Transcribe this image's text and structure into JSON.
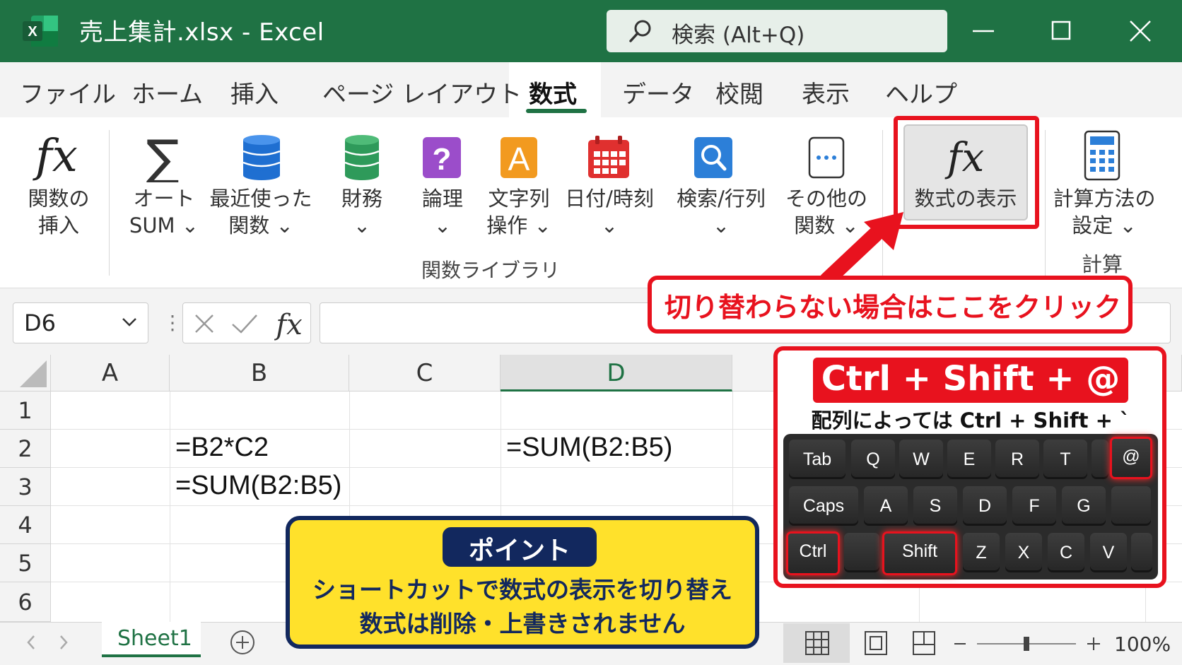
{
  "window": {
    "title": "売上集計.xlsx  -  Excel",
    "search_placeholder": "検索 (Alt+Q)",
    "brand_color": "#1f7244"
  },
  "menu": {
    "tabs": [
      "ファイル",
      "ホーム",
      "挿入",
      "ページ レイアウト",
      "数式",
      "データ",
      "校閲",
      "表示",
      "ヘルプ"
    ],
    "active_tab": "数式"
  },
  "ribbon": {
    "insert_function": {
      "line1": "関数の",
      "line2": "挿入"
    },
    "autosum": {
      "line1": "オート",
      "line2": "SUM ⌄"
    },
    "recent": {
      "line1": "最近使った",
      "line2": "関数 ⌄"
    },
    "financial": {
      "line1": "財務",
      "line2": "⌄"
    },
    "logical": {
      "line1": "論理",
      "line2": "⌄"
    },
    "text": {
      "line1": "文字列",
      "line2": "操作 ⌄"
    },
    "datetime": {
      "line1": "日付/時刻",
      "line2": "⌄"
    },
    "lookup": {
      "line1": "検索/行列",
      "line2": "⌄"
    },
    "more": {
      "line1": "その他の",
      "line2": "関数 ⌄"
    },
    "group_label": "関数ライブラリ",
    "show_formulas": "数式の表示",
    "calc_options": {
      "line1": "計算方法の",
      "line2": "設定 ⌄"
    },
    "calc_group_label": "計算"
  },
  "formula_bar": {
    "name_box": "D6",
    "formula": ""
  },
  "sheet": {
    "columns": [
      "A",
      "B",
      "C",
      "D"
    ],
    "rows": [
      "1",
      "2",
      "3",
      "4",
      "5",
      "6"
    ],
    "cells": {
      "B2": "=B2*C2",
      "B3": "=SUM(B2:B5)",
      "D2": "=SUM(B2:B5)"
    },
    "active_cell": "D6"
  },
  "status_bar": {
    "sheet_tab": "Sheet1",
    "zoom": "100%"
  },
  "annotations": {
    "callout": "切り替わらない場合はここをクリック",
    "point_title": "ポイント",
    "point_line1": "ショートカットで数式の表示を切り替え",
    "point_line2": "数式は削除・上書きされません",
    "shortcut": "Ctrl + Shift + @",
    "shortcut_alt": "配列によっては Ctrl + Shift + `",
    "highlight_color": "#e8121e",
    "point_bg_color": "#ffe12b"
  },
  "keyboard": {
    "row1": [
      "Tab",
      "Q",
      "W",
      "E",
      "R",
      "T",
      "@"
    ],
    "row2": [
      "Caps",
      "A",
      "S",
      "D",
      "F",
      "G"
    ],
    "row3": [
      "Ctrl",
      "Shift",
      "Z",
      "X",
      "C",
      "V"
    ],
    "highlighted": [
      "@",
      "Ctrl",
      "Shift"
    ]
  }
}
